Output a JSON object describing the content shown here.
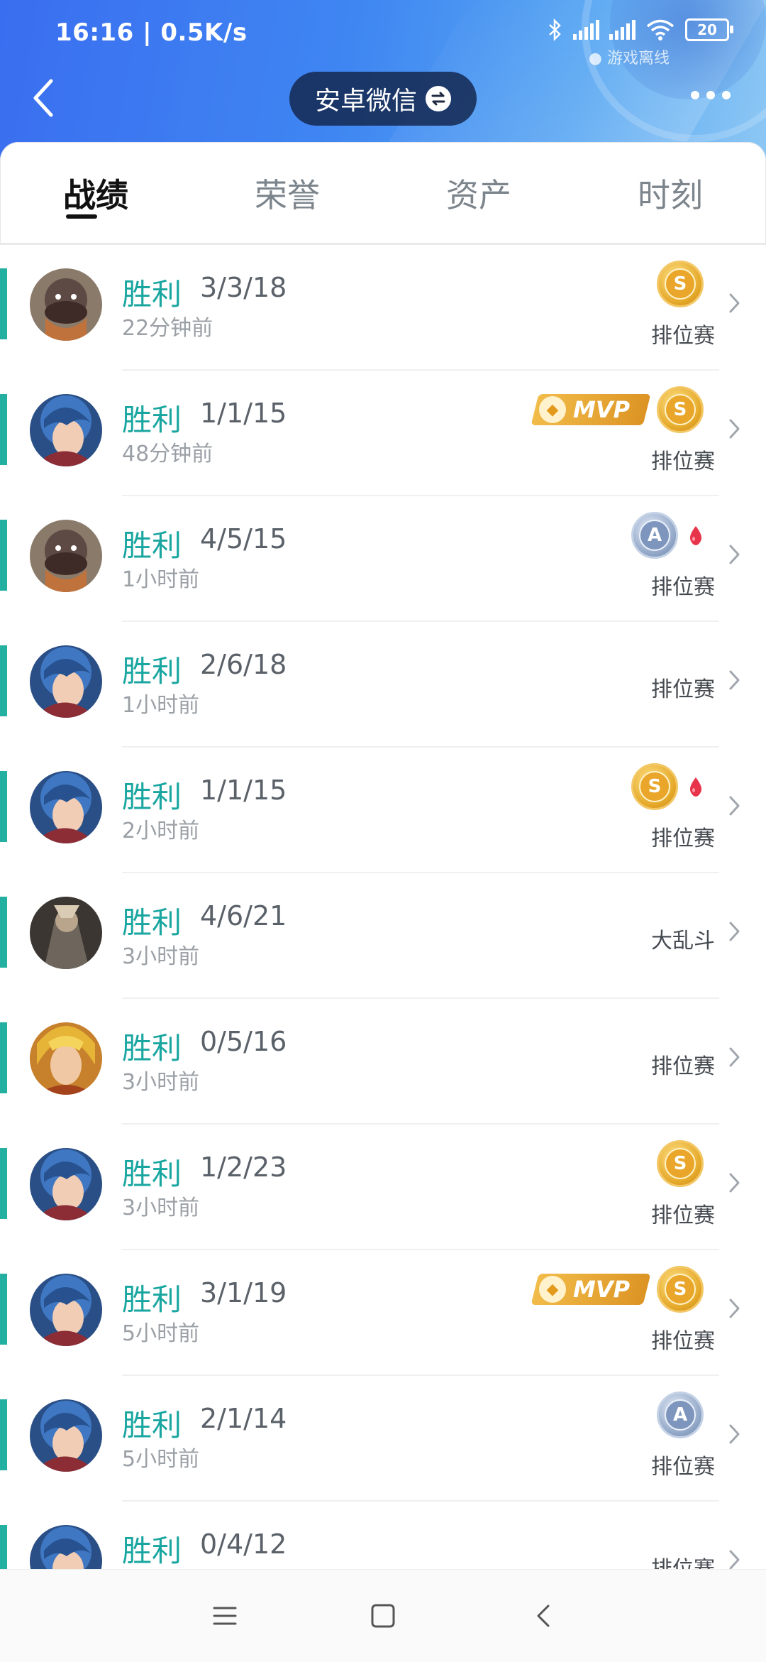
{
  "status_bar": {
    "time": "16:16 | 0.5K/s",
    "battery": "20",
    "offline_label": "游戏离线"
  },
  "header": {
    "account_label": "安卓微信"
  },
  "tabs": [
    {
      "label": "战绩"
    },
    {
      "label": "荣誉"
    },
    {
      "label": "资产"
    },
    {
      "label": "时刻"
    }
  ],
  "matches": [
    {
      "result": "胜利",
      "kda": "3/3/18",
      "time": "22分钟前",
      "mode": "排位赛",
      "mvp": false,
      "medal": "S",
      "first_blood": false,
      "hero": "boar"
    },
    {
      "result": "胜利",
      "kda": "1/1/15",
      "time": "48分钟前",
      "mode": "排位赛",
      "mvp": true,
      "medal": "S",
      "first_blood": false,
      "hero": "bluehair"
    },
    {
      "result": "胜利",
      "kda": "4/5/15",
      "time": "1小时前",
      "mode": "排位赛",
      "mvp": false,
      "medal": "A",
      "first_blood": true,
      "hero": "boar"
    },
    {
      "result": "胜利",
      "kda": "2/6/18",
      "time": "1小时前",
      "mode": "排位赛",
      "mvp": false,
      "medal": "",
      "first_blood": false,
      "hero": "bluehair"
    },
    {
      "result": "胜利",
      "kda": "1/1/15",
      "time": "2小时前",
      "mode": "排位赛",
      "mvp": false,
      "medal": "S",
      "first_blood": true,
      "hero": "bluehair"
    },
    {
      "result": "胜利",
      "kda": "4/6/21",
      "time": "3小时前",
      "mode": "大乱斗",
      "mvp": false,
      "medal": "",
      "first_blood": false,
      "hero": "warrior"
    },
    {
      "result": "胜利",
      "kda": "0/5/16",
      "time": "3小时前",
      "mode": "排位赛",
      "mvp": false,
      "medal": "",
      "first_blood": false,
      "hero": "golden"
    },
    {
      "result": "胜利",
      "kda": "1/2/23",
      "time": "3小时前",
      "mode": "排位赛",
      "mvp": false,
      "medal": "S",
      "first_blood": false,
      "hero": "bluehair"
    },
    {
      "result": "胜利",
      "kda": "3/1/19",
      "time": "5小时前",
      "mode": "排位赛",
      "mvp": true,
      "medal": "S",
      "first_blood": false,
      "hero": "bluehair"
    },
    {
      "result": "胜利",
      "kda": "2/1/14",
      "time": "5小时前",
      "mode": "排位赛",
      "mvp": false,
      "medal": "A",
      "first_blood": false,
      "hero": "bluehair"
    },
    {
      "result": "胜利",
      "kda": "0/4/12",
      "time": "",
      "mode": "排位赛",
      "mvp": false,
      "medal": "",
      "first_blood": false,
      "hero": "bluehair"
    }
  ],
  "badge_text": {
    "mvp": "MVP"
  }
}
